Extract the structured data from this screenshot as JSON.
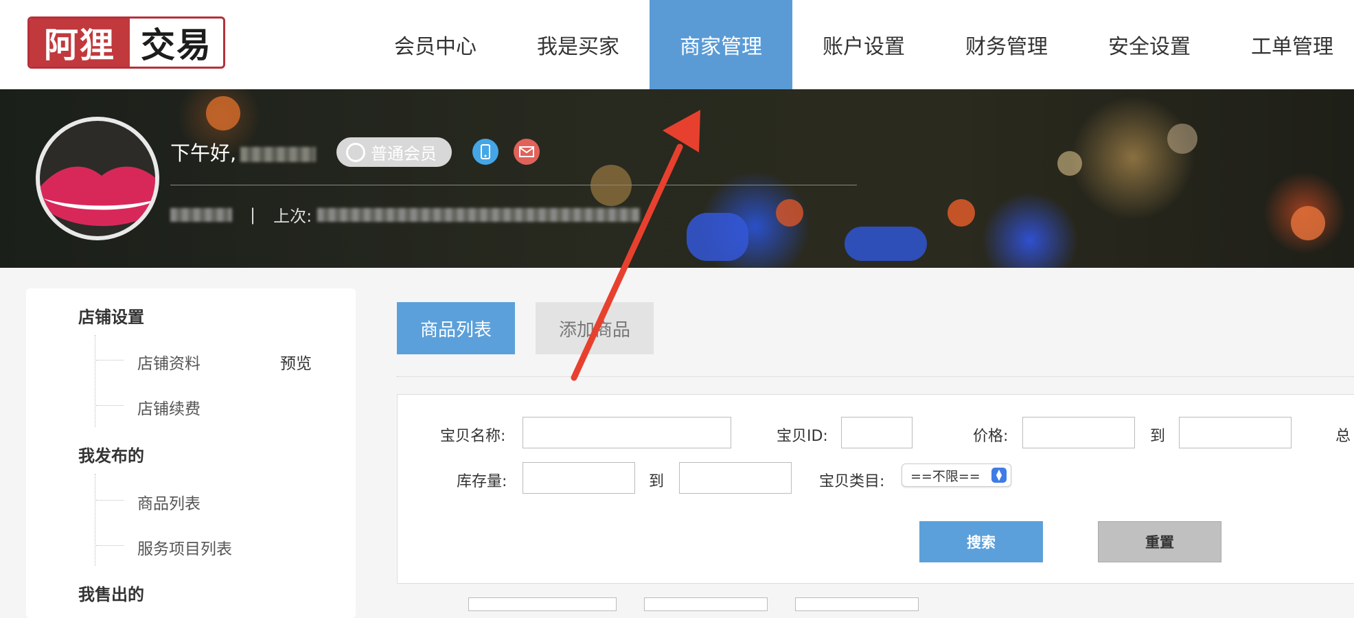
{
  "logo": {
    "part1": "阿狸",
    "part2": "交易"
  },
  "nav": {
    "items": [
      {
        "label": "会员中心"
      },
      {
        "label": "我是买家"
      },
      {
        "label": "商家管理",
        "active": true
      },
      {
        "label": "账户设置"
      },
      {
        "label": "财务管理"
      },
      {
        "label": "安全设置"
      },
      {
        "label": "工单管理"
      }
    ]
  },
  "profile": {
    "greeting": "下午好,",
    "member_level": "普通会员",
    "divider": "|",
    "last_login_label": "上次:"
  },
  "sidebar": {
    "sections": [
      {
        "title": "店铺设置",
        "items": [
          {
            "label": "店铺资料",
            "action": "预览"
          },
          {
            "label": "店铺续费"
          }
        ]
      },
      {
        "title": "我发布的",
        "items": [
          {
            "label": "商品列表"
          },
          {
            "label": "服务项目列表"
          }
        ]
      },
      {
        "title": "我售出的",
        "items": []
      }
    ]
  },
  "tabs": [
    {
      "label": "商品列表",
      "active": true
    },
    {
      "label": "添加商品"
    }
  ],
  "search_form": {
    "name_label": "宝贝名称:",
    "id_label": "宝贝ID:",
    "price_label": "价格:",
    "to_label": "到",
    "overflow_label": "总",
    "stock_label": "库存量:",
    "category_label": "宝贝类目:",
    "category_value": "==不限==",
    "search_button": "搜索",
    "reset_button": "重置"
  },
  "colors": {
    "nav_active": "#5b9bd5",
    "primary_button": "#5ba0da",
    "arrow": "#e8402e"
  }
}
